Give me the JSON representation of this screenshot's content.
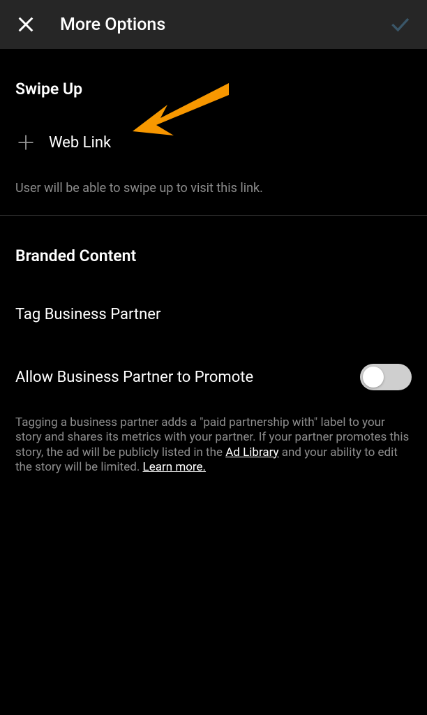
{
  "header": {
    "title": "More Options"
  },
  "swipe_up": {
    "section_title": "Swipe Up",
    "web_link_label": "Web Link",
    "hint": "User will be able to swipe up to visit this link."
  },
  "branded": {
    "section_title": "Branded Content",
    "tag_partner": "Tag Business Partner",
    "allow_promote": "Allow Business Partner to Promote",
    "description_part1": "Tagging a business partner adds a \"paid partnership with\" label to your story and shares its metrics with your partner. If your partner promotes this story, the ad will be publicly listed in the ",
    "ad_library": "Ad Library",
    "description_part2": " and your ability to edit the story will be limited. ",
    "learn_more": "Learn more."
  }
}
